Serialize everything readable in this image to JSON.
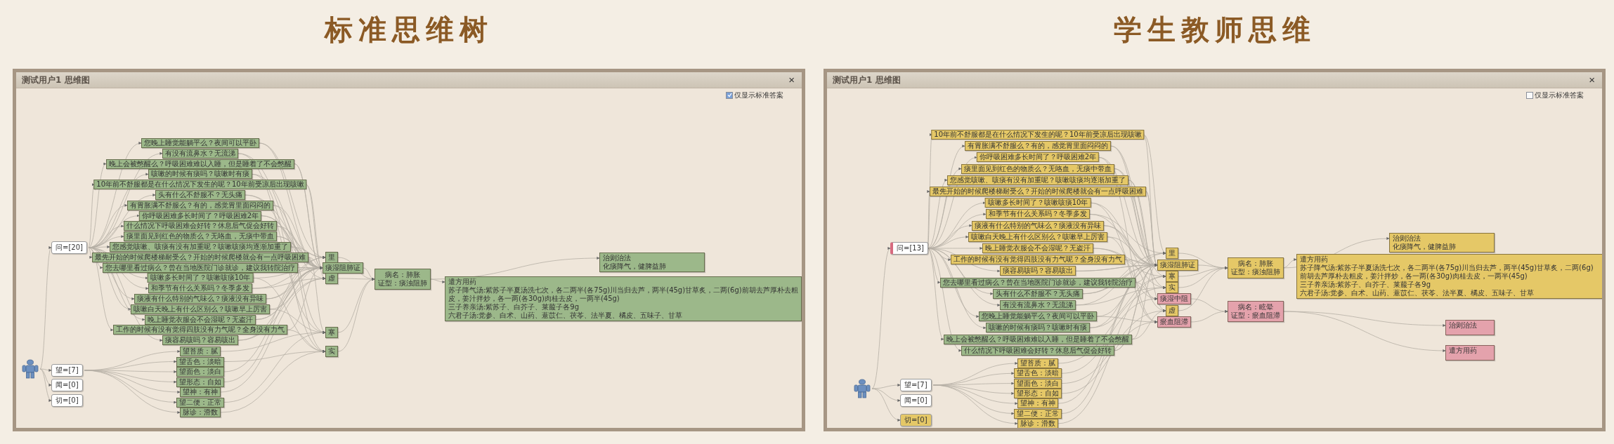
{
  "panels": [
    {
      "heading": "标准思维树",
      "window": {
        "title": "测试用户1 思维图",
        "close": "×"
      },
      "option": {
        "label": "仅显示标准答案",
        "checked": true
      },
      "categories": [
        {
          "text": "问=[20]",
          "color": "#ffffff",
          "marked": false
        },
        {
          "text": "望=[7]",
          "color": "#ffffff",
          "marked": false
        },
        {
          "text": "闻=[0]",
          "color": "#ffffff",
          "marked": false
        },
        {
          "text": "切=[0]",
          "color": "#ffffff",
          "marked": false
        }
      ],
      "questions": [
        {
          "text": "您晚上睡觉能躺平么？夜间可以平卧",
          "color": "#9cb88a"
        },
        {
          "text": "有没有流鼻水？无流涕",
          "color": "#9cb88a"
        },
        {
          "text": "晚上会被憋醒么？呼吸困难难以入睡，但是睡着了不会憋醒",
          "color": "#9cb88a"
        },
        {
          "text": "咳嗽的时候有痰吗？咳嗽时有痰",
          "color": "#9cb88a"
        },
        {
          "text": "10年前不舒服都是在什么情况下发生的呢？10年前受凉后出现咳嗽",
          "color": "#9cb88a"
        },
        {
          "text": "头有什么不舒服不？无头痛",
          "color": "#9cb88a"
        },
        {
          "text": "有胃胀满不舒服么？有的，感觉胃里面闷闷的",
          "color": "#9cb88a"
        },
        {
          "text": "你呼吸困难多长时间了？呼吸困难2年",
          "color": "#9cb88a"
        },
        {
          "text": "什么情况下呼吸困难会好转？休息后气促会好转",
          "color": "#9cb88a"
        },
        {
          "text": "痰里面见到红色的物质么？无咯血，无痰中带血",
          "color": "#9cb88a"
        },
        {
          "text": "您感觉咳嗽、咳痰有没有加重呢？咳嗽咳痰均逐渐加重了",
          "color": "#9cb88a"
        },
        {
          "text": "最先开始的时候爬楼梯耐受么？开始的时候爬楼就会有一点呼吸困难",
          "color": "#9cb88a"
        },
        {
          "text": "您去哪里看过病么？曾在当地医院门诊就诊，建议我转院治疗",
          "color": "#9cb88a"
        },
        {
          "text": "咳嗽多长时间了？咳嗽咳痰10年",
          "color": "#9cb88a"
        },
        {
          "text": "和季节有什么关系吗？冬季多发",
          "color": "#9cb88a"
        },
        {
          "text": "痰液有什么特别的气味么？痰液没有异味",
          "color": "#9cb88a"
        },
        {
          "text": "咳嗽白天晚上有什么区别么？咳嗽早上厉害",
          "color": "#9cb88a"
        },
        {
          "text": "晚上睡觉衣服会不会湿呢？无盗汗",
          "color": "#9cb88a"
        },
        {
          "text": "工作的时候有没有觉得四肢没有力气呢？全身没有力气",
          "color": "#9cb88a"
        },
        {
          "text": "痰容易咳吗？容易咳出",
          "color": "#9cb88a"
        }
      ],
      "inspections": [
        {
          "text": "望苔质：腻",
          "color": "#9cb88a"
        },
        {
          "text": "望舌色：淡暗",
          "color": "#9cb88a"
        },
        {
          "text": "望面色：淡白",
          "color": "#9cb88a"
        },
        {
          "text": "望形态：自如",
          "color": "#9cb88a"
        },
        {
          "text": "望神：有神",
          "color": "#9cb88a"
        },
        {
          "text": "望二便：正常",
          "color": "#9cb88a"
        },
        {
          "text": "脉诊：滑数",
          "color": "#9cb88a"
        }
      ],
      "syndromes": [
        {
          "text": "里",
          "color": "#9cb88a"
        },
        {
          "text": "痰湿阻肺证",
          "color": "#9cb88a"
        },
        {
          "text": "虚",
          "color": "#9cb88a"
        },
        {
          "text": "寒",
          "color": "#9cb88a"
        },
        {
          "text": "实",
          "color": "#9cb88a"
        }
      ],
      "diagnoses": [
        {
          "lines": [
            "病名：肺胀",
            "证型：痰浊阻肺"
          ],
          "color": "#9cb88a"
        }
      ],
      "plans": [
        {
          "kind": "treatment",
          "lines": [
            "治则治法",
            "化痰降气，健脾益肺"
          ],
          "color": "#9cb88a"
        },
        {
          "kind": "prescription",
          "lines": [
            "遣方用药",
            "苏子降气汤:紫苏子半夏汤洗七次，各二两半(各75g)川当归去芦，两半(45g)甘草炙，二两(6g)前胡去芦厚朴去粗皮，姜汁拌炒，各一两(各30g)肉桂去皮，一两半(45g)",
            "三子养亲汤:紫苏子、白芥子、莱菔子各9g",
            "六君子汤:党参、白术、山药、薏苡仁、茯苓、法半夏、橘皮、五味子、甘草"
          ],
          "color": "#9cb88a"
        }
      ]
    },
    {
      "heading": "学生教师思维",
      "window": {
        "title": "测试用户1 思维图",
        "close": "×"
      },
      "option": {
        "label": "仅显示标准答案",
        "checked": false
      },
      "categories": [
        {
          "text": "问=[13]",
          "color": "#ffffff",
          "marked": true
        },
        {
          "text": "望=[7]",
          "color": "#ffffff",
          "marked": false
        },
        {
          "text": "闻=[0]",
          "color": "#ffffff",
          "marked": false
        },
        {
          "text": "切=[0]",
          "color": "#e5c867",
          "marked": false
        }
      ],
      "questions": [
        {
          "text": "10年前不舒服都是在什么情况下发生的呢？10年前受凉后出现咳嗽",
          "color": "#e5c867"
        },
        {
          "text": "有胃胀满不舒服么？有的，感觉胃里面闷闷的",
          "color": "#e5c867"
        },
        {
          "text": "你呼吸困难多长时间了？呼吸困难2年",
          "color": "#e5c867"
        },
        {
          "text": "痰里面见到红色的物质么？无咯血，无痰中带血",
          "color": "#e5c867"
        },
        {
          "text": "您感觉咳嗽、咳痰有没有加重呢？咳嗽咳痰均逐渐加重了",
          "color": "#e5c867"
        },
        {
          "text": "最先开始的时候爬楼梯耐受么？开始的时候爬楼就会有一点呼吸困难",
          "color": "#e5c867"
        },
        {
          "text": "咳嗽多长时间了？咳嗽咳痰10年",
          "color": "#e5c867"
        },
        {
          "text": "和季节有什么关系吗？冬季多发",
          "color": "#e5c867"
        },
        {
          "text": "痰液有什么特别的气味么？痰液没有异味",
          "color": "#e5c867"
        },
        {
          "text": "咳嗽白天晚上有什么区别么？咳嗽早上厉害",
          "color": "#e5c867"
        },
        {
          "text": "晚上睡觉衣服会不会湿呢？无盗汗",
          "color": "#e5c867"
        },
        {
          "text": "工作的时候有没有觉得四肢没有力气呢？全身没有力气",
          "color": "#e5c867"
        },
        {
          "text": "痰容易咳吗？容易咳出",
          "color": "#e5c867"
        },
        {
          "text": "您去哪里看过病么？曾在当地医院门诊就诊，建议我转院治疗",
          "color": "#9cb88a"
        },
        {
          "text": "头有什么不舒服不？无头痛",
          "color": "#9cb88a"
        },
        {
          "text": "有没有流鼻水？无流涕",
          "color": "#9cb88a"
        },
        {
          "text": "您晚上睡觉能躺平么？夜间可以平卧",
          "color": "#9cb88a"
        },
        {
          "text": "咳嗽的时候有痰吗？咳嗽时有痰",
          "color": "#9cb88a"
        },
        {
          "text": "晚上会被憋醒么？呼吸困难难以入睡，但是睡着了不会憋醒",
          "color": "#9cb88a"
        },
        {
          "text": "什么情况下呼吸困难会好转？休息后气促会好转",
          "color": "#9cb88a"
        }
      ],
      "inspections": [
        {
          "text": "望苔质：腻",
          "color": "#e5c867"
        },
        {
          "text": "望舌色：淡暗",
          "color": "#e5c867"
        },
        {
          "text": "望面色：淡白",
          "color": "#e5c867"
        },
        {
          "text": "望形态：自如",
          "color": "#e5c867"
        },
        {
          "text": "望神：有神",
          "color": "#e5c867"
        },
        {
          "text": "望二便：正常",
          "color": "#e5c867"
        },
        {
          "text": "脉诊：滑数",
          "color": "#e5c867"
        }
      ],
      "syndromes": [
        {
          "text": "里",
          "color": "#e5c867"
        },
        {
          "text": "痰湿阻肺证",
          "color": "#e5c867"
        },
        {
          "text": "寒",
          "color": "#e5c867"
        },
        {
          "text": "实",
          "color": "#e5c867"
        },
        {
          "text": "痰湿中阻",
          "color": "#e4a2ac"
        },
        {
          "text": "虚",
          "color": "#e5c867"
        },
        {
          "text": "瘀血阻滞",
          "color": "#e4a2ac"
        }
      ],
      "diagnoses": [
        {
          "lines": [
            "病名：肺胀",
            "证型：痰浊阻肺"
          ],
          "color": "#e5c867"
        },
        {
          "lines": [
            "病名：眩晕",
            "证型：瘀血阻滞"
          ],
          "color": "#e4a2ac"
        }
      ],
      "plans": [
        {
          "kind": "treatment",
          "lines": [
            "治则治法",
            "化痰降气，健脾益肺"
          ],
          "color": "#e5c867"
        },
        {
          "kind": "prescription",
          "lines": [
            "遣方用药",
            "苏子降气汤:紫苏子半夏汤洗七次，各二两半(各75g)川当归去芦，两半(45g)甘草炙，二两(6g)前胡去芦厚朴去粗皮，姜汁拌炒，各一两(各30g)肉桂去皮，一两半(45g)",
            "三子养亲汤:紫苏子、白芥子、莱菔子各9g",
            "六君子汤:党参、白术、山药、薏苡仁、茯苓、法半夏、橘皮、五味子、甘草"
          ],
          "color": "#e5c867"
        },
        {
          "kind": "treatment",
          "lines": [
            "治则治法"
          ],
          "color": "#e4a2ac"
        },
        {
          "kind": "prescription",
          "lines": [
            "遣方用药"
          ],
          "color": "#e4a2ac"
        }
      ]
    }
  ]
}
